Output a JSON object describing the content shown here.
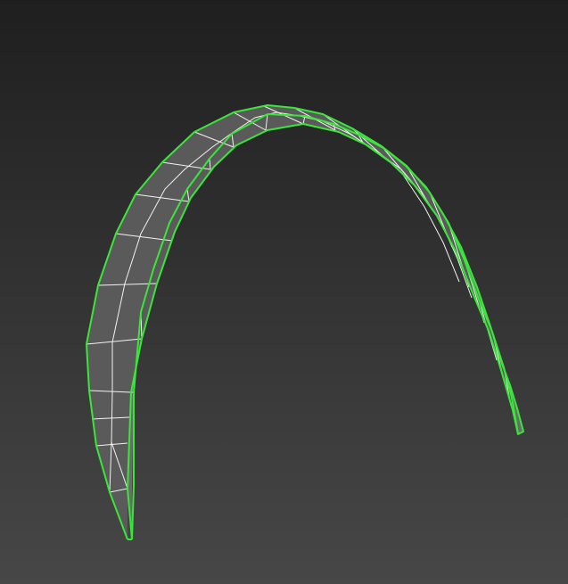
{
  "viewport": {
    "view": "perspective",
    "shading": "default-shading-with-edged-faces",
    "background_top": "#1f1f1f",
    "background_bottom": "#474747"
  },
  "object": {
    "kind": "curved-band-mesh",
    "selected": true,
    "selection_color": "#39e639",
    "face_color": "#5a5a5a",
    "side_face_color": "#6b6b6b",
    "wire_color": "#f2f2f2"
  }
}
